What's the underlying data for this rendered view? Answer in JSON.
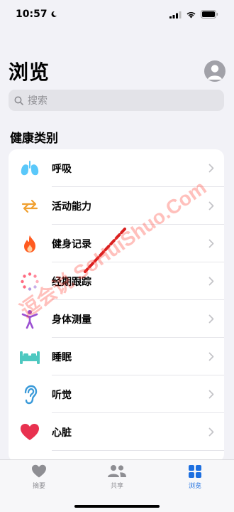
{
  "status": {
    "time": "10:57"
  },
  "header": {
    "title": "浏览"
  },
  "search": {
    "placeholder": "搜索"
  },
  "section": {
    "title": "健康类别"
  },
  "categories": [
    {
      "label": "呼吸",
      "icon": "lungs-icon",
      "color": "#5ac8fa"
    },
    {
      "label": "活动能力",
      "icon": "arrows-icon",
      "color": "#f0a030"
    },
    {
      "label": "健身记录",
      "icon": "flame-icon",
      "color": "#ff5a1f"
    },
    {
      "label": "经期跟踪",
      "icon": "cycle-dots-icon",
      "color": "#ff6a80"
    },
    {
      "label": "身体测量",
      "icon": "figure-icon",
      "color": "#9b4fd1"
    },
    {
      "label": "睡眠",
      "icon": "bed-icon",
      "color": "#4dc8c0"
    },
    {
      "label": "听觉",
      "icon": "ear-icon",
      "color": "#3a9ad9"
    },
    {
      "label": "心脏",
      "icon": "heart-icon",
      "color": "#ff2d55"
    }
  ],
  "tabs": [
    {
      "label": "摘要",
      "icon": "heart-icon",
      "active": false
    },
    {
      "label": "共享",
      "icon": "people-icon",
      "active": false
    },
    {
      "label": "浏览",
      "icon": "grid-icon",
      "active": true
    }
  ],
  "watermark": {
    "text": "逗会说 SoHuiShuo.Com",
    "color": "#ff3b30"
  }
}
